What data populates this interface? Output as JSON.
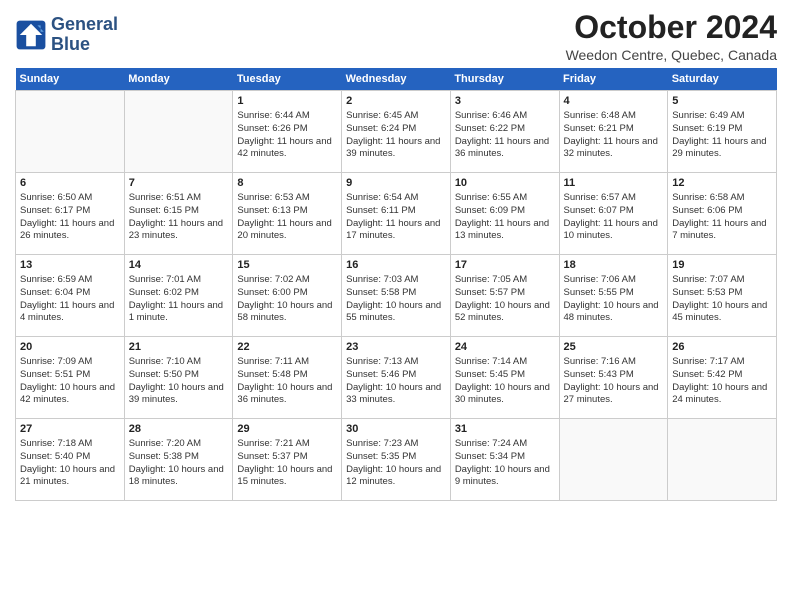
{
  "header": {
    "logo_line1": "General",
    "logo_line2": "Blue",
    "title": "October 2024",
    "location": "Weedon Centre, Quebec, Canada"
  },
  "weekdays": [
    "Sunday",
    "Monday",
    "Tuesday",
    "Wednesday",
    "Thursday",
    "Friday",
    "Saturday"
  ],
  "weeks": [
    [
      {
        "day": "",
        "info": ""
      },
      {
        "day": "",
        "info": ""
      },
      {
        "day": "1",
        "info": "Sunrise: 6:44 AM\nSunset: 6:26 PM\nDaylight: 11 hours and 42 minutes."
      },
      {
        "day": "2",
        "info": "Sunrise: 6:45 AM\nSunset: 6:24 PM\nDaylight: 11 hours and 39 minutes."
      },
      {
        "day": "3",
        "info": "Sunrise: 6:46 AM\nSunset: 6:22 PM\nDaylight: 11 hours and 36 minutes."
      },
      {
        "day": "4",
        "info": "Sunrise: 6:48 AM\nSunset: 6:21 PM\nDaylight: 11 hours and 32 minutes."
      },
      {
        "day": "5",
        "info": "Sunrise: 6:49 AM\nSunset: 6:19 PM\nDaylight: 11 hours and 29 minutes."
      }
    ],
    [
      {
        "day": "6",
        "info": "Sunrise: 6:50 AM\nSunset: 6:17 PM\nDaylight: 11 hours and 26 minutes."
      },
      {
        "day": "7",
        "info": "Sunrise: 6:51 AM\nSunset: 6:15 PM\nDaylight: 11 hours and 23 minutes."
      },
      {
        "day": "8",
        "info": "Sunrise: 6:53 AM\nSunset: 6:13 PM\nDaylight: 11 hours and 20 minutes."
      },
      {
        "day": "9",
        "info": "Sunrise: 6:54 AM\nSunset: 6:11 PM\nDaylight: 11 hours and 17 minutes."
      },
      {
        "day": "10",
        "info": "Sunrise: 6:55 AM\nSunset: 6:09 PM\nDaylight: 11 hours and 13 minutes."
      },
      {
        "day": "11",
        "info": "Sunrise: 6:57 AM\nSunset: 6:07 PM\nDaylight: 11 hours and 10 minutes."
      },
      {
        "day": "12",
        "info": "Sunrise: 6:58 AM\nSunset: 6:06 PM\nDaylight: 11 hours and 7 minutes."
      }
    ],
    [
      {
        "day": "13",
        "info": "Sunrise: 6:59 AM\nSunset: 6:04 PM\nDaylight: 11 hours and 4 minutes."
      },
      {
        "day": "14",
        "info": "Sunrise: 7:01 AM\nSunset: 6:02 PM\nDaylight: 11 hours and 1 minute."
      },
      {
        "day": "15",
        "info": "Sunrise: 7:02 AM\nSunset: 6:00 PM\nDaylight: 10 hours and 58 minutes."
      },
      {
        "day": "16",
        "info": "Sunrise: 7:03 AM\nSunset: 5:58 PM\nDaylight: 10 hours and 55 minutes."
      },
      {
        "day": "17",
        "info": "Sunrise: 7:05 AM\nSunset: 5:57 PM\nDaylight: 10 hours and 52 minutes."
      },
      {
        "day": "18",
        "info": "Sunrise: 7:06 AM\nSunset: 5:55 PM\nDaylight: 10 hours and 48 minutes."
      },
      {
        "day": "19",
        "info": "Sunrise: 7:07 AM\nSunset: 5:53 PM\nDaylight: 10 hours and 45 minutes."
      }
    ],
    [
      {
        "day": "20",
        "info": "Sunrise: 7:09 AM\nSunset: 5:51 PM\nDaylight: 10 hours and 42 minutes."
      },
      {
        "day": "21",
        "info": "Sunrise: 7:10 AM\nSunset: 5:50 PM\nDaylight: 10 hours and 39 minutes."
      },
      {
        "day": "22",
        "info": "Sunrise: 7:11 AM\nSunset: 5:48 PM\nDaylight: 10 hours and 36 minutes."
      },
      {
        "day": "23",
        "info": "Sunrise: 7:13 AM\nSunset: 5:46 PM\nDaylight: 10 hours and 33 minutes."
      },
      {
        "day": "24",
        "info": "Sunrise: 7:14 AM\nSunset: 5:45 PM\nDaylight: 10 hours and 30 minutes."
      },
      {
        "day": "25",
        "info": "Sunrise: 7:16 AM\nSunset: 5:43 PM\nDaylight: 10 hours and 27 minutes."
      },
      {
        "day": "26",
        "info": "Sunrise: 7:17 AM\nSunset: 5:42 PM\nDaylight: 10 hours and 24 minutes."
      }
    ],
    [
      {
        "day": "27",
        "info": "Sunrise: 7:18 AM\nSunset: 5:40 PM\nDaylight: 10 hours and 21 minutes."
      },
      {
        "day": "28",
        "info": "Sunrise: 7:20 AM\nSunset: 5:38 PM\nDaylight: 10 hours and 18 minutes."
      },
      {
        "day": "29",
        "info": "Sunrise: 7:21 AM\nSunset: 5:37 PM\nDaylight: 10 hours and 15 minutes."
      },
      {
        "day": "30",
        "info": "Sunrise: 7:23 AM\nSunset: 5:35 PM\nDaylight: 10 hours and 12 minutes."
      },
      {
        "day": "31",
        "info": "Sunrise: 7:24 AM\nSunset: 5:34 PM\nDaylight: 10 hours and 9 minutes."
      },
      {
        "day": "",
        "info": ""
      },
      {
        "day": "",
        "info": ""
      }
    ]
  ]
}
